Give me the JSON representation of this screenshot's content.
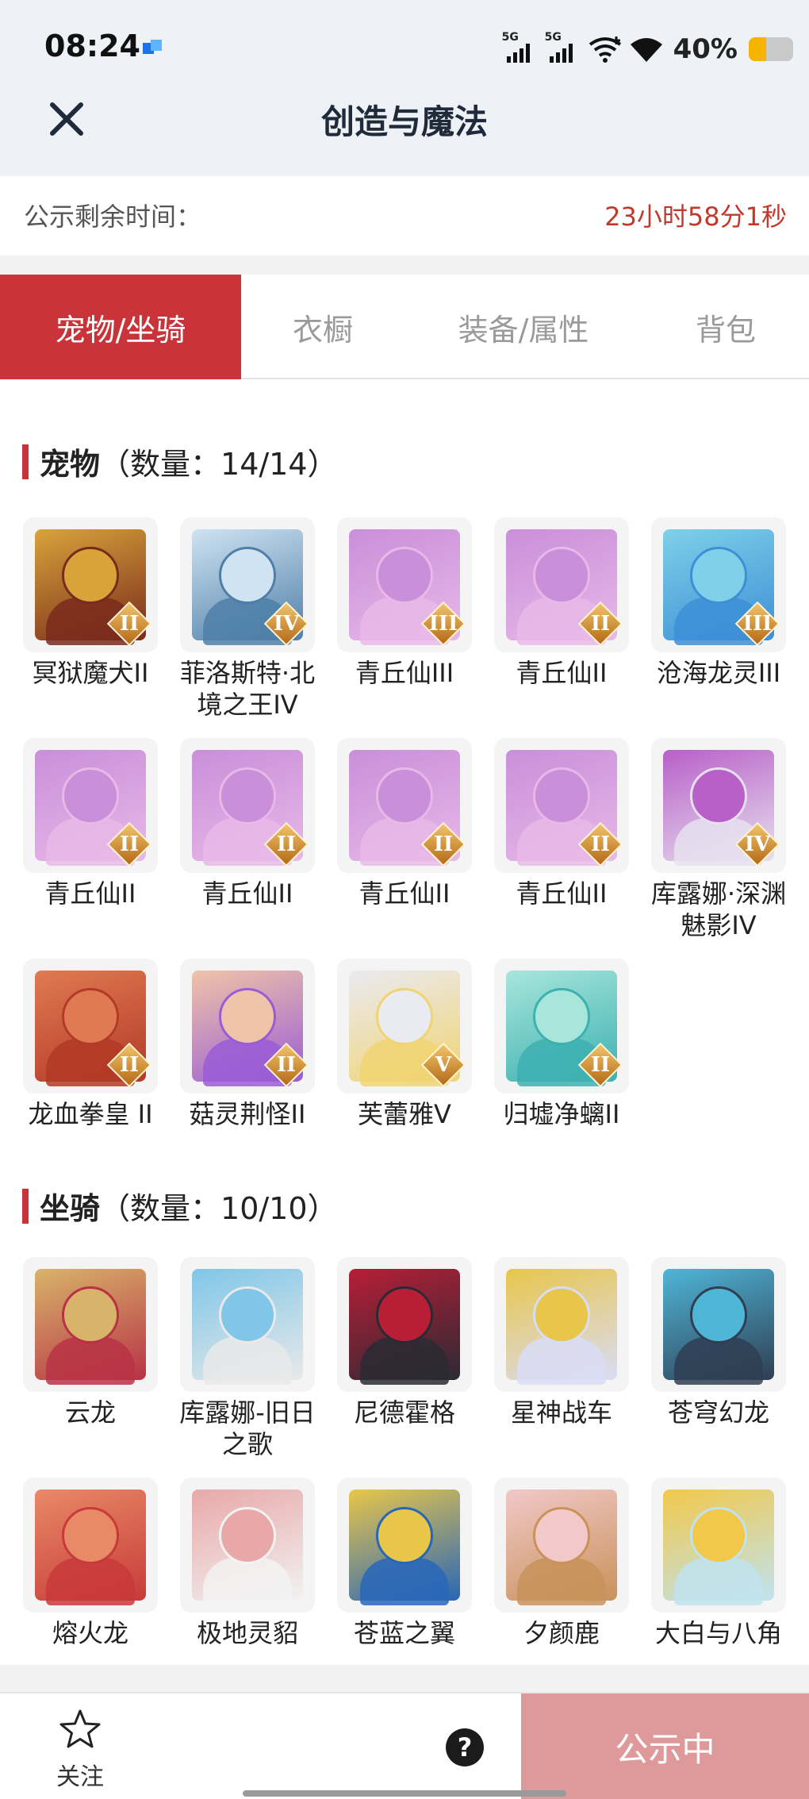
{
  "status_bar": {
    "time": "08:24",
    "signal1_label": "5G",
    "signal2_label": "5G",
    "battery_percent": "40%",
    "battery_level": 0.4
  },
  "header": {
    "title": "创造与魔法"
  },
  "notice": {
    "label": "公示剩余时间：",
    "value": "23小时58分1秒"
  },
  "tabs": [
    {
      "label": "宠物/坐骑",
      "active": true
    },
    {
      "label": "衣橱",
      "active": false
    },
    {
      "label": "装备/属性",
      "active": false
    },
    {
      "label": "背包",
      "active": false
    }
  ],
  "sections": {
    "pets": {
      "title": "宠物",
      "count": "（数量：14/14）",
      "items": [
        {
          "name": "冥狱魔犬II",
          "tier": "II",
          "colors": [
            "#7a2a1c",
            "#d8a43a"
          ]
        },
        {
          "name": "菲洛斯特·北境之王IV",
          "tier": "IV",
          "colors": [
            "#4f7fa8",
            "#cfe3f2"
          ]
        },
        {
          "name": "青丘仙III",
          "tier": "III",
          "colors": [
            "#e8b8e8",
            "#c98fd9"
          ]
        },
        {
          "name": "青丘仙II",
          "tier": "II",
          "colors": [
            "#e8b8e8",
            "#c98fd9"
          ]
        },
        {
          "name": "沧海龙灵III",
          "tier": "III",
          "colors": [
            "#3d8fd6",
            "#7fd0e8"
          ]
        },
        {
          "name": "青丘仙II",
          "tier": "II",
          "colors": [
            "#e8b8e8",
            "#c98fd9"
          ]
        },
        {
          "name": "青丘仙II",
          "tier": "II",
          "colors": [
            "#e8b8e8",
            "#c98fd9"
          ]
        },
        {
          "name": "青丘仙II",
          "tier": "II",
          "colors": [
            "#e8b8e8",
            "#c98fd9"
          ]
        },
        {
          "name": "青丘仙II",
          "tier": "II",
          "colors": [
            "#e8b8e8",
            "#c98fd9"
          ]
        },
        {
          "name": "库露娜·深渊魅影IV",
          "tier": "IV",
          "colors": [
            "#e6e0ee",
            "#b85fc8"
          ]
        },
        {
          "name": "龙血拳皇 II",
          "tier": "II",
          "colors": [
            "#b23a26",
            "#e07a52"
          ]
        },
        {
          "name": "菇灵荆怪II",
          "tier": "II",
          "colors": [
            "#9a5cd6",
            "#f0c4a8"
          ]
        },
        {
          "name": "芙蕾雅V",
          "tier": "V",
          "colors": [
            "#f0d472",
            "#eaeaf2"
          ]
        },
        {
          "name": "归墟净螭II",
          "tier": "II",
          "colors": [
            "#3db0b0",
            "#a8e6dc"
          ]
        }
      ]
    },
    "mounts": {
      "title": "坐骑",
      "count": "（数量：10/10）",
      "items": [
        {
          "name": "云龙",
          "colors": [
            "#b83246",
            "#d8b46a"
          ]
        },
        {
          "name": "库露娜-旧日之歌",
          "colors": [
            "#e9e9e9",
            "#7fc6e8"
          ]
        },
        {
          "name": "尼德霍格",
          "colors": [
            "#2a2a34",
            "#b81e36"
          ]
        },
        {
          "name": "星神战车",
          "colors": [
            "#d9dcf6",
            "#e8c64a"
          ]
        },
        {
          "name": "苍穹幻龙",
          "colors": [
            "#2f3e52",
            "#4fb6d8"
          ]
        },
        {
          "name": "熔火龙",
          "colors": [
            "#c83a3a",
            "#e88a66"
          ]
        },
        {
          "name": "极地灵貂",
          "colors": [
            "#f2f2f2",
            "#e8a8a8"
          ]
        },
        {
          "name": "苍蓝之翼",
          "colors": [
            "#2866b8",
            "#e8c64a"
          ]
        },
        {
          "name": "夕颜鹿",
          "colors": [
            "#c8925a",
            "#f2c8c8"
          ]
        },
        {
          "name": "大白与八角",
          "colors": [
            "#bfe3ef",
            "#f2c84a"
          ]
        }
      ]
    }
  },
  "bottom_bar": {
    "follow_label": "关注",
    "help_label": "?",
    "action_label": "公示中"
  }
}
